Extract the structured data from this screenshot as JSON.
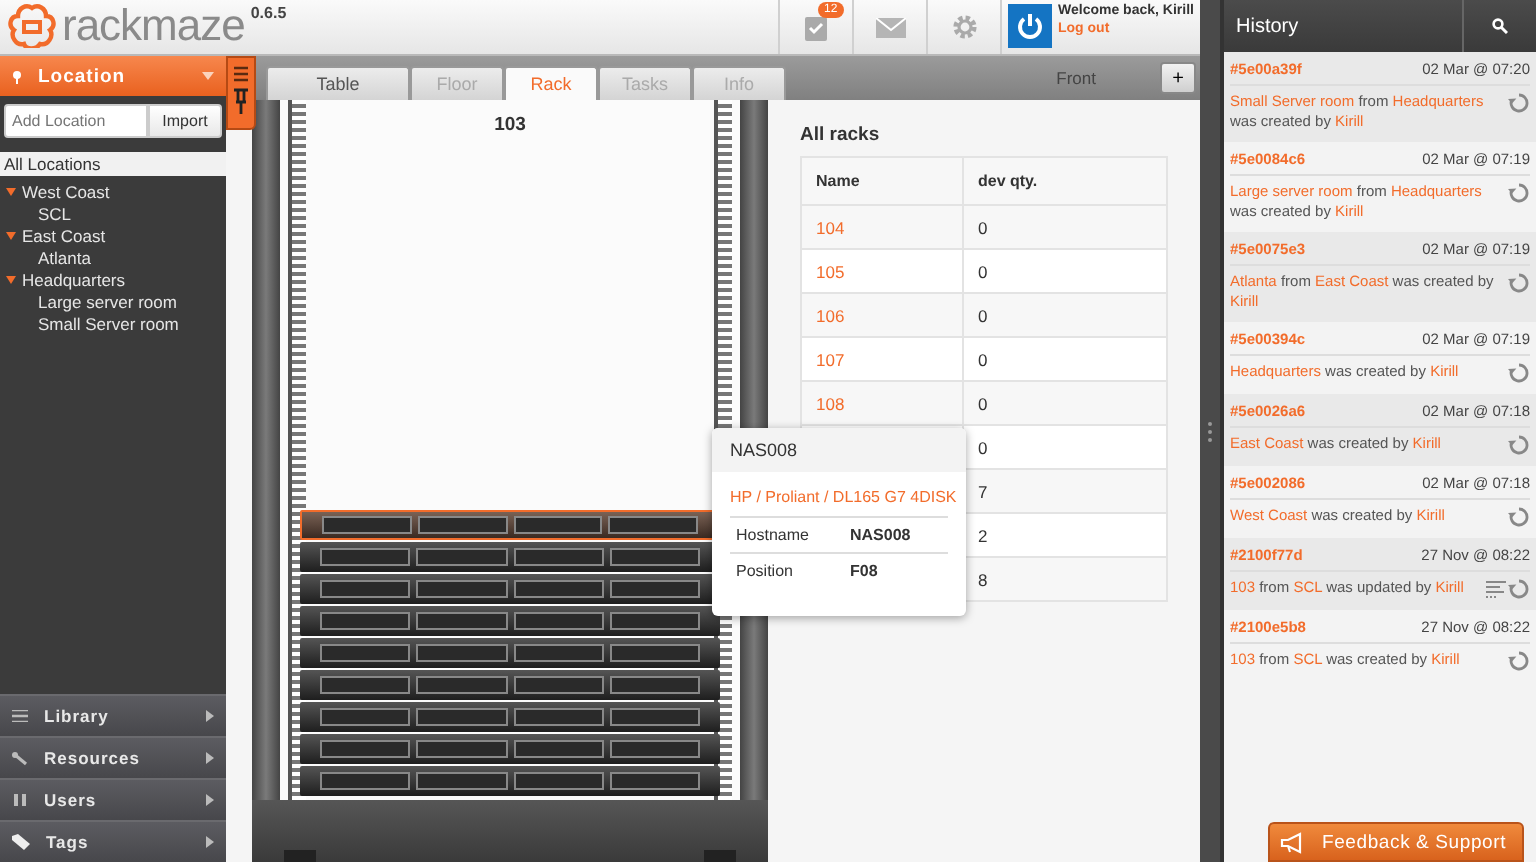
{
  "header": {
    "logo": "rackmaze",
    "version": "0.6.5",
    "tasks_badge": "12",
    "welcome": "Welcome back, Kirill",
    "logout": "Log out"
  },
  "sidebar": {
    "section": "Location",
    "add_placeholder": "Add Location",
    "import": "Import",
    "all_locations": {
      "label": "All Locations",
      "selected": true
    },
    "tree": [
      {
        "label": "West Coast",
        "expanded": true,
        "selected": false,
        "children": [
          {
            "label": "SCL",
            "selected": false
          }
        ]
      },
      {
        "label": "East Coast",
        "expanded": true,
        "selected": false,
        "children": [
          {
            "label": "Atlanta",
            "selected": false
          }
        ]
      },
      {
        "label": "Headquarters",
        "expanded": true,
        "selected": false,
        "children": [
          {
            "label": "Large server room",
            "selected": false
          },
          {
            "label": "Small Server room",
            "selected": false
          }
        ]
      }
    ],
    "nav": [
      {
        "label": "Library",
        "kind": "library"
      },
      {
        "label": "Resources",
        "kind": "resources"
      },
      {
        "label": "Users",
        "kind": "users"
      },
      {
        "label": "Tags",
        "kind": "tags"
      }
    ]
  },
  "tabs": [
    {
      "label": "Table",
      "selected": false,
      "disabled": false
    },
    {
      "label": "Floor",
      "selected": false,
      "disabled": true
    },
    {
      "label": "Rack",
      "selected": true,
      "disabled": false
    },
    {
      "label": "Tasks",
      "selected": false,
      "disabled": true
    },
    {
      "label": "Info",
      "selected": false,
      "disabled": true
    }
  ],
  "view_side": "Front",
  "add_button": "+",
  "rack": {
    "title": "103",
    "devices": [
      {
        "selected": true
      },
      {
        "selected": false
      },
      {
        "selected": false
      },
      {
        "selected": false
      },
      {
        "selected": false
      },
      {
        "selected": false
      },
      {
        "selected": false
      },
      {
        "selected": false
      },
      {
        "selected": false
      }
    ]
  },
  "racks_table": {
    "title": "All racks",
    "columns": [
      "Name",
      "dev qty."
    ],
    "rows": [
      {
        "name": "104",
        "qty": "0"
      },
      {
        "name": "105",
        "qty": "0"
      },
      {
        "name": "106",
        "qty": "0"
      },
      {
        "name": "107",
        "qty": "0"
      },
      {
        "name": "108",
        "qty": "0"
      },
      {
        "qty": "0"
      },
      {
        "qty": "7"
      },
      {
        "qty": "2"
      },
      {
        "qty": "8"
      }
    ]
  },
  "tooltip": {
    "title": "NAS008",
    "model": "HP / Proliant / DL165 G7 4DISK",
    "fields": [
      {
        "label": "Hostname",
        "value": "NAS008"
      },
      {
        "label": "Position",
        "value": "F08"
      }
    ]
  },
  "history": {
    "title": "History",
    "items": [
      {
        "id": "#5e00a39f",
        "time": "02 Mar @ 07:20",
        "details": false,
        "message": [
          {
            "text": "Small Server room",
            "link": true
          },
          {
            "text": " from ",
            "link": false
          },
          {
            "text": "Headquarters",
            "link": true
          },
          {
            "text": " was created by ",
            "link": false
          },
          {
            "text": "Kirill",
            "link": true
          }
        ]
      },
      {
        "id": "#5e0084c6",
        "time": "02 Mar @ 07:19",
        "details": false,
        "message": [
          {
            "text": "Large server room",
            "link": true
          },
          {
            "text": " from ",
            "link": false
          },
          {
            "text": "Headquarters",
            "link": true
          },
          {
            "text": " was created by ",
            "link": false
          },
          {
            "text": "Kirill",
            "link": true
          }
        ]
      },
      {
        "id": "#5e0075e3",
        "time": "02 Mar @ 07:19",
        "details": false,
        "message": [
          {
            "text": "Atlanta",
            "link": true
          },
          {
            "text": " from ",
            "link": false
          },
          {
            "text": "East Coast",
            "link": true
          },
          {
            "text": " was created by ",
            "link": false
          },
          {
            "text": "Kirill",
            "link": true
          }
        ]
      },
      {
        "id": "#5e00394c",
        "time": "02 Mar @ 07:19",
        "details": false,
        "message": [
          {
            "text": "Headquarters",
            "link": true
          },
          {
            "text": " was created by ",
            "link": false
          },
          {
            "text": "Kirill",
            "link": true
          }
        ]
      },
      {
        "id": "#5e0026a6",
        "time": "02 Mar @ 07:18",
        "details": false,
        "message": [
          {
            "text": "East Coast",
            "link": true
          },
          {
            "text": " was created by ",
            "link": false
          },
          {
            "text": "Kirill",
            "link": true
          }
        ]
      },
      {
        "id": "#5e002086",
        "time": "02 Mar @ 07:18",
        "details": false,
        "message": [
          {
            "text": "West Coast",
            "link": true
          },
          {
            "text": " was created by ",
            "link": false
          },
          {
            "text": "Kirill",
            "link": true
          }
        ]
      },
      {
        "id": "#2100f77d",
        "time": "27 Nov @ 08:22",
        "details": true,
        "message": [
          {
            "text": "103",
            "link": true
          },
          {
            "text": " from ",
            "link": false
          },
          {
            "text": "SCL",
            "link": true
          },
          {
            "text": " was updated by ",
            "link": false
          },
          {
            "text": "Kirill",
            "link": true
          }
        ]
      },
      {
        "id": "#2100e5b8",
        "time": "27 Nov @ 08:22",
        "details": false,
        "message": [
          {
            "text": "103",
            "link": true
          },
          {
            "text": " from ",
            "link": false
          },
          {
            "text": "SCL",
            "link": true
          },
          {
            "text": " was created by ",
            "link": false
          },
          {
            "text": "Kirill",
            "link": true
          }
        ]
      }
    ]
  },
  "feedback": "Feedback & Support"
}
